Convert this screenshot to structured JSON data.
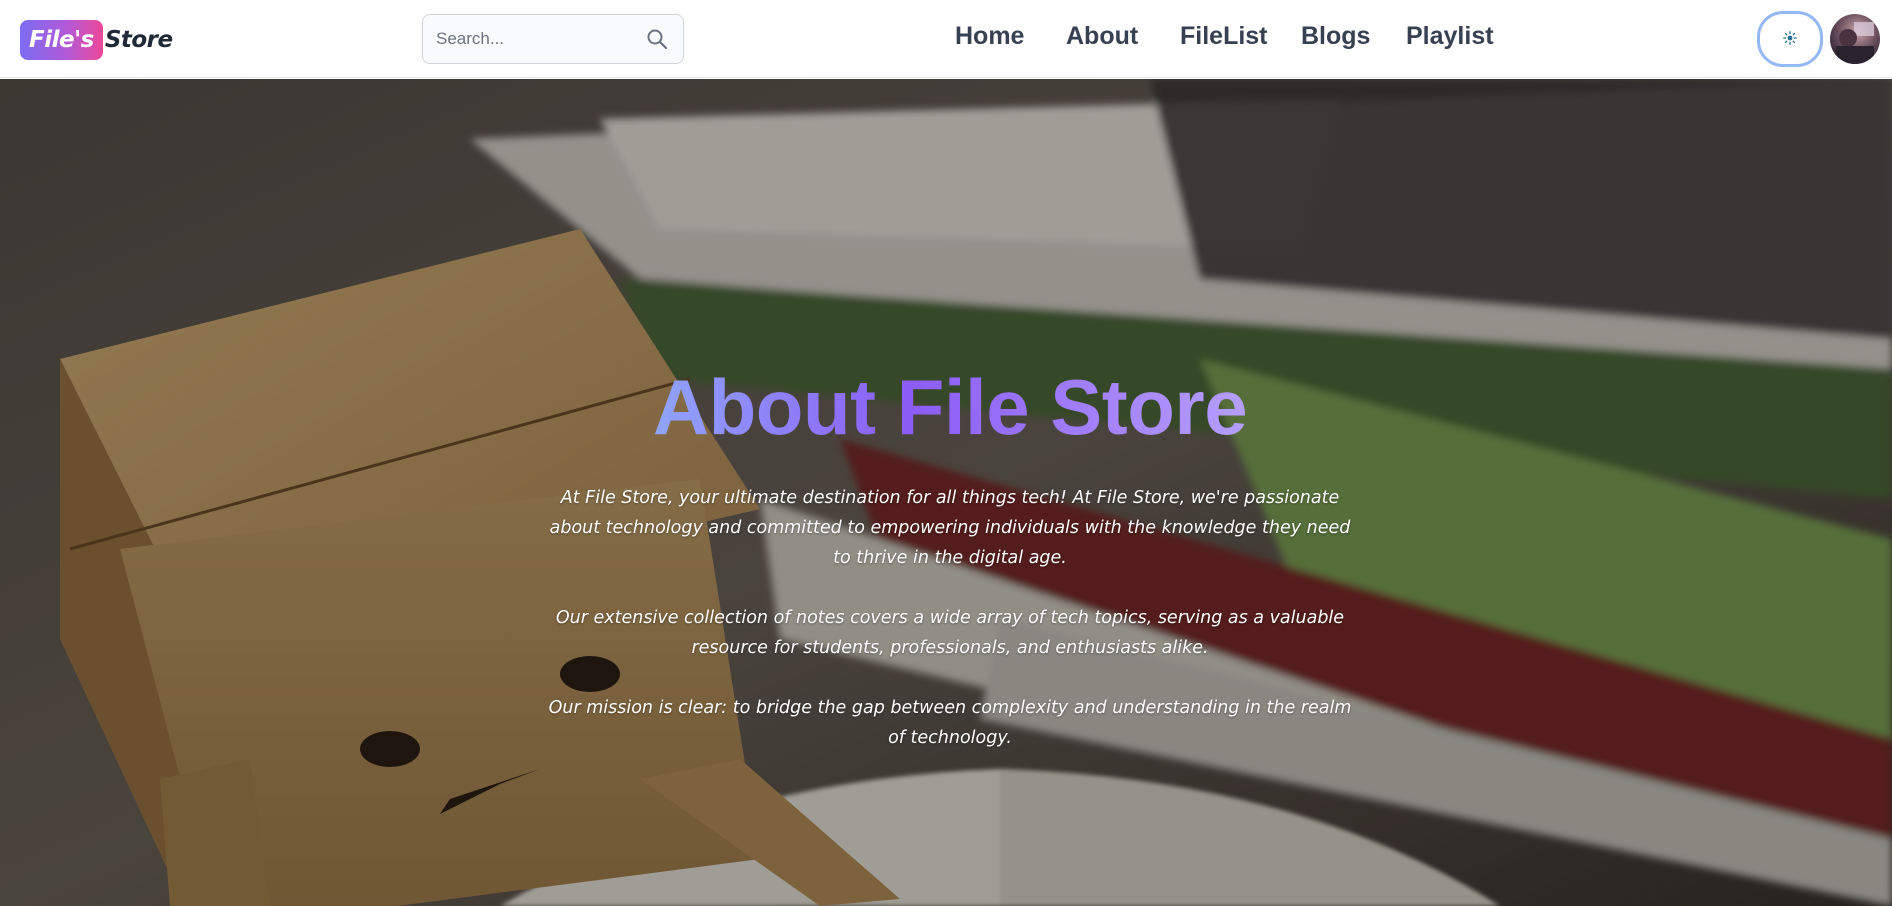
{
  "brand": {
    "badge": "File's",
    "name": "Store"
  },
  "search": {
    "placeholder": "Search..."
  },
  "nav": {
    "home": "Home",
    "about": "About",
    "filelist": "FileList",
    "blogs": "Blogs",
    "playlist": "Playlist"
  },
  "icons": {
    "search": "search-icon",
    "theme": "sun-icon",
    "avatar": "user-avatar"
  },
  "colors": {
    "brand_start": "#7c6cf2",
    "brand_end": "#ec4899",
    "title_start": "#93c5fd",
    "title_mid": "#8b5cf6",
    "title_end": "#c4b5fd",
    "nav_text": "#374151"
  },
  "hero": {
    "title": "About File Store",
    "paragraphs": [
      "At File Store, your ultimate destination for all things tech! At File Store, we're passionate about technology and committed to empowering individuals with the knowledge they need to thrive in the digital age.",
      "Our extensive collection of notes covers a wide array of tech topics, serving as a valuable resource for students, professionals, and enthusiasts alike.",
      "Our mission is clear: to bridge the gap between complexity and understanding in the realm of technology."
    ]
  }
}
